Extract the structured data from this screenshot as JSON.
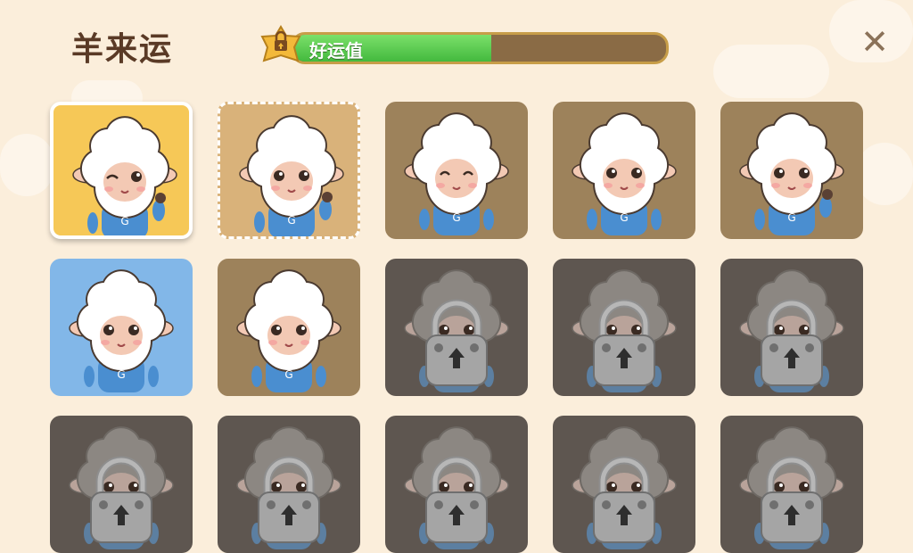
{
  "title": "羊来运",
  "lucky_meter": {
    "label": "好运值",
    "progress": 0.53,
    "badge_icon": "lock-star-badge-icon"
  },
  "close_icon": "close-icon",
  "colors": {
    "gold": "#f6c857",
    "tan": "#d9b27a",
    "brown": "#9d825b",
    "blue": "#82b7e8",
    "locked": "#5e5650",
    "progress": "#5fcf52"
  },
  "cards": [
    {
      "state": "selected",
      "bg": "#f6c857",
      "pose": "wink-wave"
    },
    {
      "state": "unlocked-dashed",
      "bg": "#d9b27a",
      "pose": "wave"
    },
    {
      "state": "unlocked",
      "bg": "#9d825b",
      "pose": "happy"
    },
    {
      "state": "unlocked",
      "bg": "#9d825b",
      "pose": "stand"
    },
    {
      "state": "unlocked",
      "bg": "#9d825b",
      "pose": "wave"
    },
    {
      "state": "unlocked",
      "bg": "#82b7e8",
      "pose": "stand"
    },
    {
      "state": "unlocked",
      "bg": "#9d825b",
      "pose": "stand"
    },
    {
      "state": "locked",
      "bg": "#5e5650",
      "pose": "stand"
    },
    {
      "state": "locked",
      "bg": "#5e5650",
      "pose": "stand"
    },
    {
      "state": "locked",
      "bg": "#5e5650",
      "pose": "stand"
    },
    {
      "state": "locked",
      "bg": "#5e5650",
      "pose": "stand"
    },
    {
      "state": "locked",
      "bg": "#5e5650",
      "pose": "stand"
    },
    {
      "state": "locked",
      "bg": "#5e5650",
      "pose": "stand"
    },
    {
      "state": "locked",
      "bg": "#5e5650",
      "pose": "stand"
    },
    {
      "state": "locked",
      "bg": "#5e5650",
      "pose": "stand"
    }
  ]
}
